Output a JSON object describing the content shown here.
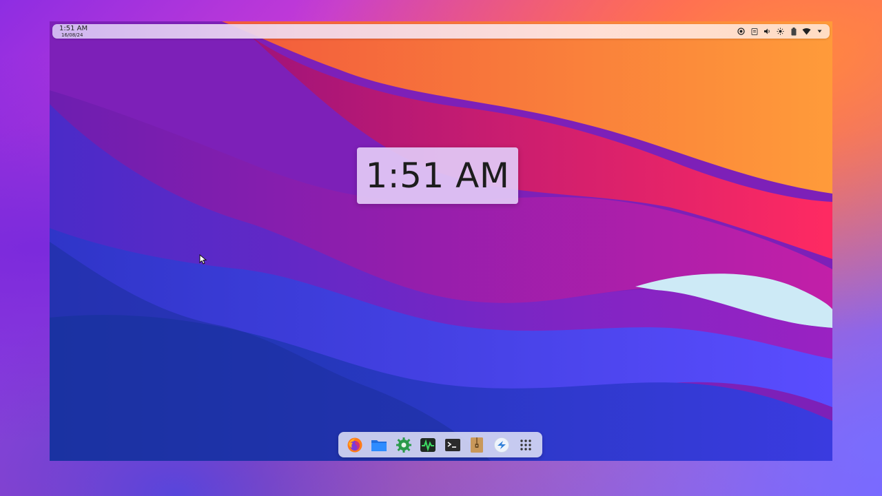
{
  "topbar": {
    "time": "1:51 AM",
    "date": "16/08/24",
    "tray_icons": [
      "screen-record-icon",
      "clipboard-icon",
      "volume-icon",
      "brightness-icon",
      "battery-icon",
      "wifi-icon",
      "chevron-down-icon"
    ]
  },
  "osd": {
    "time": "1:51 AM"
  },
  "dock": {
    "apps": [
      {
        "name": "firefox-icon"
      },
      {
        "name": "files-icon"
      },
      {
        "name": "settings-icon"
      },
      {
        "name": "system-monitor-icon"
      },
      {
        "name": "terminal-icon"
      },
      {
        "name": "archive-manager-icon"
      },
      {
        "name": "software-center-icon"
      },
      {
        "name": "app-grid-icon"
      }
    ]
  },
  "colors": {
    "wave_orange": "#ff7a2e",
    "wave_pink": "#e0176b",
    "wave_purple": "#9b1fb5",
    "wave_violet": "#6a2bd0",
    "wave_blue": "#4640ee",
    "wave_navy": "#1f3bb0",
    "wave_light": "#c8ecf7"
  }
}
